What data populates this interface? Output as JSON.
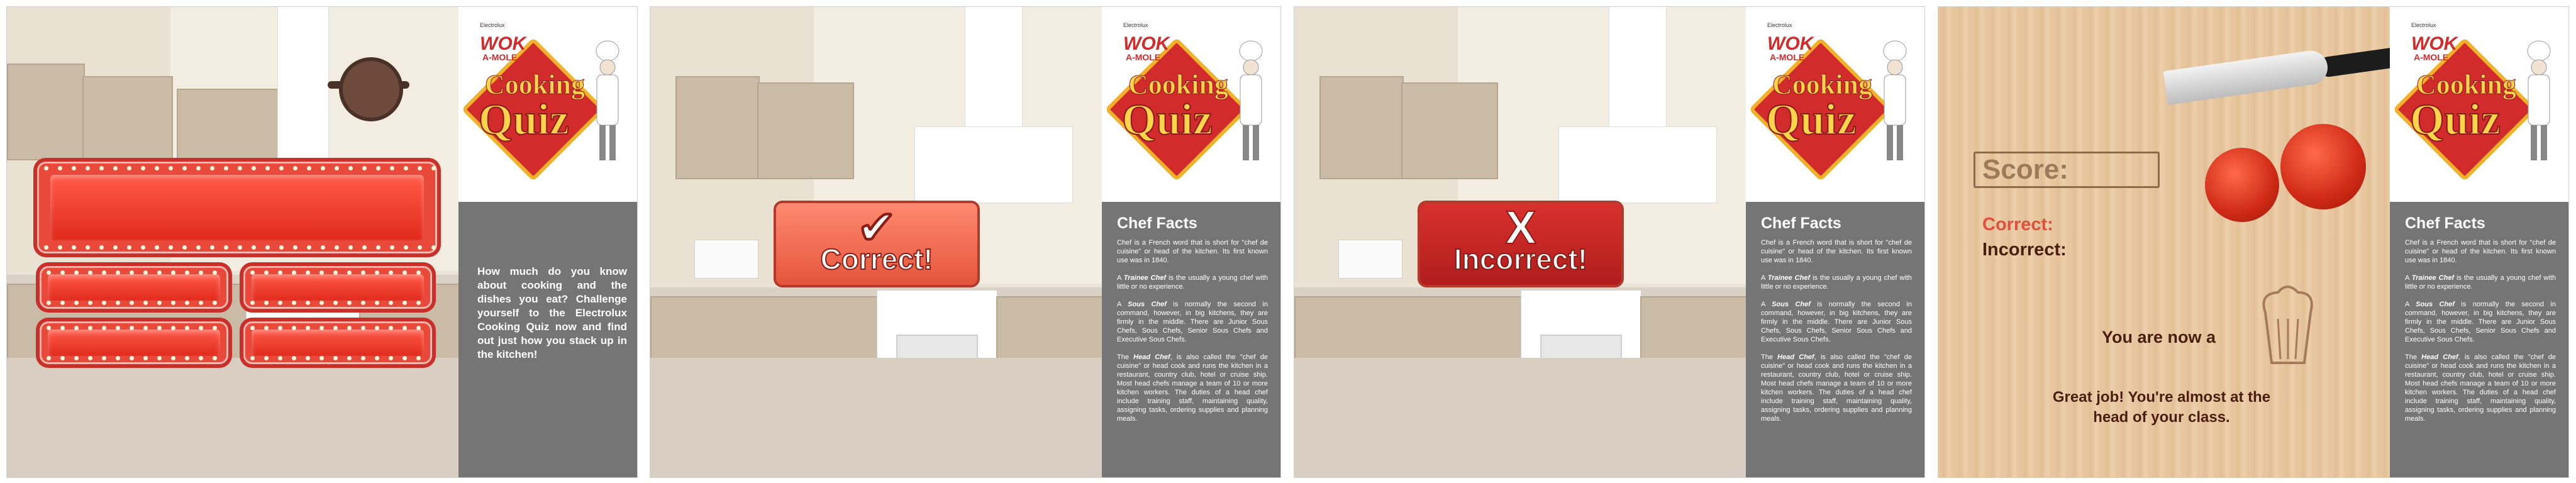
{
  "brand": {
    "maker": "Electrolux",
    "title_line1": "WOK",
    "title_line2": "A-MOLE",
    "title_cooking": "Cooking",
    "title_quiz": "Quiz"
  },
  "start_screen": {
    "intro": "How much do you know about cooking and the dishes you eat? Challenge yourself to the Electrolux Cooking Quiz now and find out just how you stack up in the kitchen!"
  },
  "feedback": {
    "correct_label": "Correct!",
    "correct_mark": "✔",
    "incorrect_label": "Incorrect!",
    "incorrect_mark": "X"
  },
  "chef_facts": {
    "title": "Chef Facts",
    "p1": "Chef is a French word that is short for \"chef de cuisine\" or head of the kitchen. Its first known use was in 1840.",
    "p2_term": "Trainee Chef",
    "p2_rest": " is the usually a young chef with little or no experience.",
    "p3_pre": "A ",
    "p3_term": "Sous Chef",
    "p3_rest": " is normally the second in command, however, in big kitchens, they are firmly in the middle. There are Junior Sous Chefs, Sous Chefs, Senior Sous Chefs and Executive Sous Chefs.",
    "p4_pre": "The ",
    "p4_term": "Head Chef",
    "p4_rest": ", is also called the \"chef de cuisine\" or head cook and runs the kitchen in a restaurant, country club, hotel or cruise ship. Most head chefs manage a team of 10 or more kitchen workers. The duties of a head chef include training staff, maintaining quality, assigning tasks, ordering supplies and planning meals."
  },
  "results": {
    "score_label": "Score:",
    "correct_label": "Correct:",
    "incorrect_label": "Incorrect:",
    "rank_text": "You are now a",
    "message": "Great job! You're almost at the head of your class."
  },
  "colors": {
    "accent": "#e1503b",
    "sidebar": "#757575",
    "brown": "#4a1f10"
  }
}
